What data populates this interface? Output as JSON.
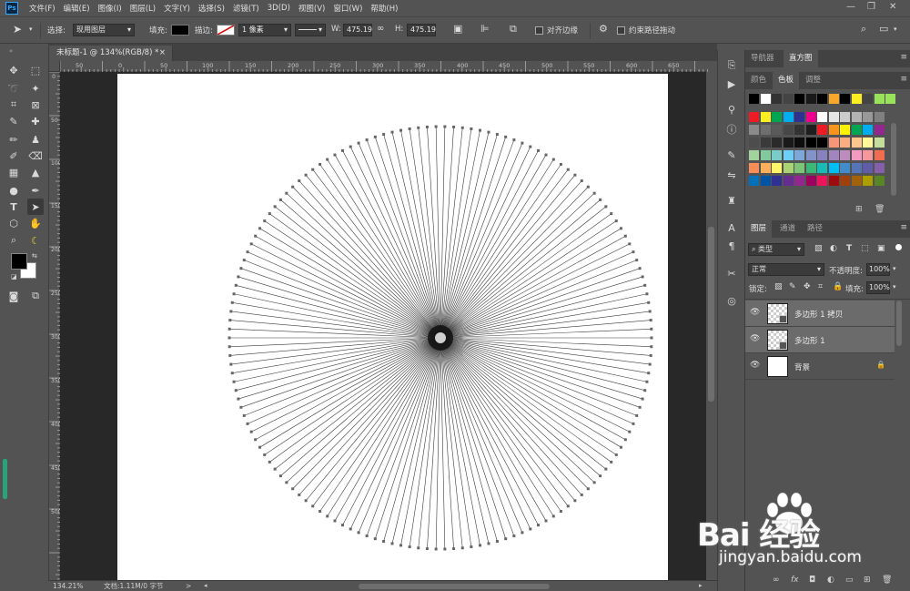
{
  "app": {
    "logo": "Ps",
    "menu": [
      "文件(F)",
      "编辑(E)",
      "图像(I)",
      "图层(L)",
      "文字(Y)",
      "选择(S)",
      "滤镜(T)",
      "3D(D)",
      "视图(V)",
      "窗口(W)",
      "帮助(H)"
    ],
    "window_controls": [
      "—",
      "❐",
      "✕"
    ]
  },
  "options_bar": {
    "select_label": "选择:",
    "select_value": "现用图层",
    "fill_label": "填充:",
    "stroke_label": "描边:",
    "stroke_width": "1 像素",
    "w_label": "W:",
    "w_value": "475.19",
    "h_label": "H:",
    "h_value": "475.19",
    "align_edges_label": "对齐边缘",
    "constrain_path_label": "约束路径拖动"
  },
  "document": {
    "tab_title": "未标题-1 @ 134%(RGB/8) *",
    "close": "×"
  },
  "ruler_top_labels": [
    "50",
    "0",
    "50",
    "100",
    "150",
    "200",
    "250",
    "300",
    "350",
    "400",
    "450",
    "500",
    "550",
    "600",
    "650"
  ],
  "ruler_left_labels": [
    "0",
    "50",
    "100",
    "150",
    "200",
    "250",
    "300",
    "350",
    "400",
    "450",
    "500"
  ],
  "status_bar": {
    "zoom": "134.21%",
    "doc_info": "文档:1.11M/0 字节",
    "arrow": ">"
  },
  "navigator_tabs": [
    "导航器",
    "直方图"
  ],
  "color_tabs": [
    "颜色",
    "色板",
    "调整"
  ],
  "swatch_colors": [
    [
      "#000000",
      "#ffffff",
      "#333333",
      "#444444",
      "#000000",
      "#1a1a1a",
      "#000000",
      "#f7a82b",
      "#000000",
      "#fcee21",
      "#444444",
      "#98e35a",
      "#98e35a"
    ],
    [
      "#ed1c24",
      "#fcee21",
      "#00a651",
      "#00aeef",
      "#2e3192",
      "#ec008c",
      "#ffffff",
      "#e6e6e6",
      "#cccccc",
      "#b3b3b3",
      "#999999",
      "#808080"
    ],
    [
      "#8a8a8a",
      "#6e6e6e",
      "#5a5a5a",
      "#474747",
      "#333333",
      "#1f1f1f",
      "#ed1c24",
      "#f7941d",
      "#fff200",
      "#00a651",
      "#00aeef",
      "#92278f"
    ],
    [
      "#4d4d4d",
      "#3a3a3a",
      "#2a2a2a",
      "#1a1a1a",
      "#0d0d0d",
      "#000000",
      "#000000",
      "#f69679",
      "#f9ad81",
      "#fdc68a",
      "#fff799",
      "#c4df9b"
    ],
    [
      "#a3d39c",
      "#82ca9c",
      "#7accc8",
      "#6dcff6",
      "#7da7d9",
      "#8393ca",
      "#8781bd",
      "#a186be",
      "#bd8cbf",
      "#f49ac1",
      "#f5989d",
      "#f26c4f"
    ],
    [
      "#f68e56",
      "#fbaf5d",
      "#fff568",
      "#acd373",
      "#7cc576",
      "#3bb878",
      "#1abbb4",
      "#00bff3",
      "#438ccb",
      "#5574b9",
      "#605ca8",
      "#855fa8"
    ],
    [
      "#0072bc",
      "#0054a6",
      "#2e3192",
      "#662d91",
      "#92278f",
      "#9e005d",
      "#ed145b",
      "#9e0b0f",
      "#a0410d",
      "#a36209",
      "#aba000",
      "#598527"
    ]
  ],
  "layer_tabs": [
    "图层",
    "通道",
    "路径"
  ],
  "layers_panel": {
    "filter_label": "类型",
    "blend_mode": "正常",
    "opacity_label": "不透明度:",
    "opacity_value": "100%",
    "lock_label": "锁定:",
    "fill_label": "填充:",
    "fill_value": "100%",
    "layers": [
      {
        "name": "多边形 1 拷贝",
        "selected": true,
        "type": "shape"
      },
      {
        "name": "多边形 1",
        "selected": true,
        "type": "shape"
      },
      {
        "name": "背景",
        "selected": false,
        "type": "background"
      }
    ],
    "bottom_icons": [
      "link-icon",
      "fx-icon",
      "mask-icon",
      "adjustment-icon",
      "group-icon",
      "new-layer-icon",
      "trash-icon"
    ]
  },
  "watermark": {
    "text": "Bai 经验",
    "url": "jingyan.baidu.com"
  }
}
